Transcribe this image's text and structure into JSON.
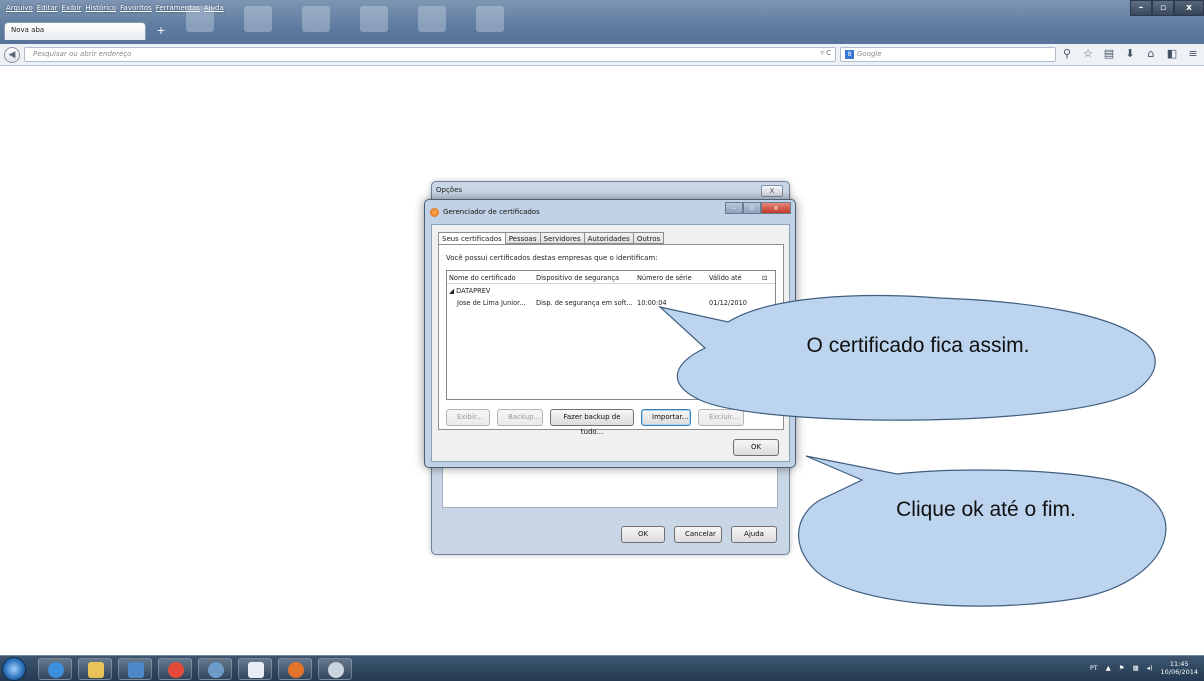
{
  "browser": {
    "menu": [
      "Arquivo",
      "Editar",
      "Exibir",
      "Histórico",
      "Favoritos",
      "Ferramentas",
      "Ajuda"
    ],
    "tab_title": "Nova aba",
    "new_tab": "+",
    "url_placeholder": "Pesquisar ou abrir endereço",
    "url_controls": "▿ C",
    "search_placeholder": "Google",
    "search_engine_badge": "8",
    "window_buttons": [
      "–",
      "▫",
      "x"
    ]
  },
  "options_dialog": {
    "title": "Opções",
    "close": "X",
    "buttons": {
      "ok": "OK",
      "cancel": "Cancelar",
      "help": "Ajuda"
    }
  },
  "cert_manager": {
    "title": "Gerenciador de certificados",
    "tabs": [
      "Seus certificados",
      "Pessoas",
      "Servidores",
      "Autoridades",
      "Outros"
    ],
    "active_tab": "Seus certificados",
    "description": "Você possui certificados destas empresas que o identificam:",
    "columns": [
      "Nome do certificado",
      "Dispositivo de segurança",
      "Número de série",
      "Válido até"
    ],
    "group": "◢ DATAPREV",
    "rows": [
      {
        "name": "Jose de Lima Junior...",
        "device": "Disp. de segurança em soft...",
        "serial": "10:00:04",
        "valid": "01/12/2010"
      }
    ],
    "actions": {
      "view": "Exibir...",
      "backup": "Backup...",
      "backup_all": "Fazer backup de tudo...",
      "import": "Importar...",
      "delete": "Excluir..."
    },
    "ok": "OK"
  },
  "callouts": {
    "first": "O certificado fica assim.",
    "second": "Clique ok até o fim."
  },
  "taskbar": {
    "language": "PT",
    "time": "11:45",
    "date": "10/06/2014"
  },
  "colors": {
    "callout_fill": "#bcd4ee",
    "callout_stroke": "#3f5f80",
    "taskbar": "#2d4560"
  }
}
